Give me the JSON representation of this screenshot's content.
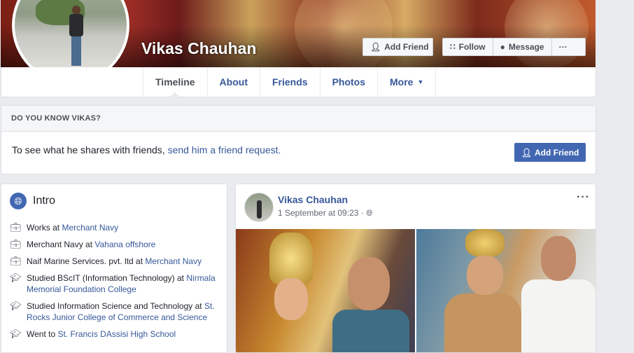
{
  "profile": {
    "name": "Vikas Chauhan"
  },
  "cover_buttons": {
    "add_friend": "Add Friend",
    "follow": "Follow",
    "message": "Message",
    "more": "···"
  },
  "tabs": [
    {
      "label": "Timeline",
      "active": true
    },
    {
      "label": "About"
    },
    {
      "label": "Friends"
    },
    {
      "label": "Photos"
    },
    {
      "label": "More"
    }
  ],
  "know": {
    "heading": "DO YOU KNOW VIKAS?",
    "text": "To see what he shares with friends, ",
    "link": "send him a friend request.",
    "button": "Add Friend"
  },
  "intro": {
    "title": "Intro",
    "items": [
      {
        "icon": "briefcase-icon",
        "prefix": "Works at ",
        "link": "Merchant Navy",
        "suffix": ""
      },
      {
        "icon": "briefcase-icon",
        "prefix": "Merchant Navy at ",
        "link": "Vahana offshore",
        "suffix": ""
      },
      {
        "icon": "briefcase-icon",
        "prefix": "Naif Marine Services. pvt. ltd at ",
        "link": "Merchant Navy",
        "suffix": ""
      },
      {
        "icon": "graduation-cap-icon",
        "prefix": "Studied BScIT (Information Technology) at ",
        "link": "Nirmala Memorial Foundation College",
        "suffix": ""
      },
      {
        "icon": "graduation-cap-icon",
        "prefix": "Studied Information Science and Technology at ",
        "link": "St. Rocks Junior College of Commerce and Science",
        "suffix": ""
      },
      {
        "icon": "graduation-cap-icon",
        "prefix": "Went to ",
        "link": "St. Francis DAssisi High School",
        "suffix": ""
      }
    ]
  },
  "post": {
    "author": "Vikas Chauhan",
    "date": "1 September at 09:23",
    "separator": "·",
    "privacy_icon": "globe-icon",
    "menu": "···"
  },
  "colors": {
    "link": "#365899",
    "primary_button": "#4267b2",
    "page_bg": "#e9ebee"
  }
}
